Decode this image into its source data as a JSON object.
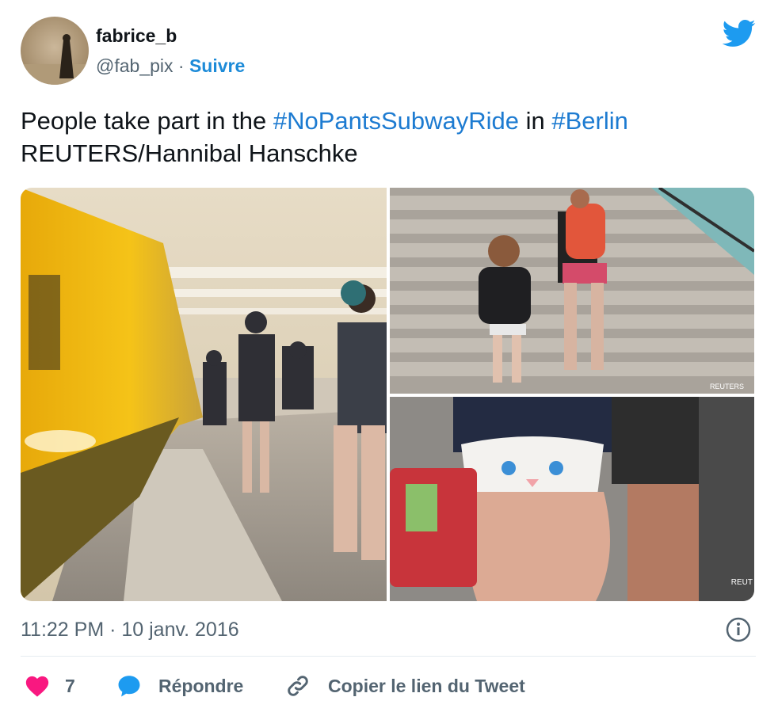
{
  "author": {
    "display_name": "fabrice_b",
    "handle": "@fab_pix",
    "separator": " · ",
    "follow_label": "Suivre"
  },
  "tweet": {
    "text_1": "People take part in the ",
    "hashtag_1": "#NoPantsSubwayRide",
    "text_2": " in ",
    "hashtag_2": "#Berlin",
    "line_2": "REUTERS/Hannibal Hanschke"
  },
  "media": {
    "photo_1": "subway-platform-photo",
    "photo_2": "stairs-photo",
    "photo_3": "cat-underwear-photo",
    "watermark_1": "REUTERS",
    "watermark_2": "REUT"
  },
  "meta": {
    "timestamp": "11:22 PM · 10 janv. 2016"
  },
  "actions": {
    "like_count": "7",
    "reply_label": "Répondre",
    "copy_link_label": "Copier le lien du Tweet"
  },
  "colors": {
    "link_blue": "#1d7bd1",
    "twitter_blue": "#1d9bf0",
    "like_pink": "#f91880",
    "muted_gray": "#536471"
  }
}
